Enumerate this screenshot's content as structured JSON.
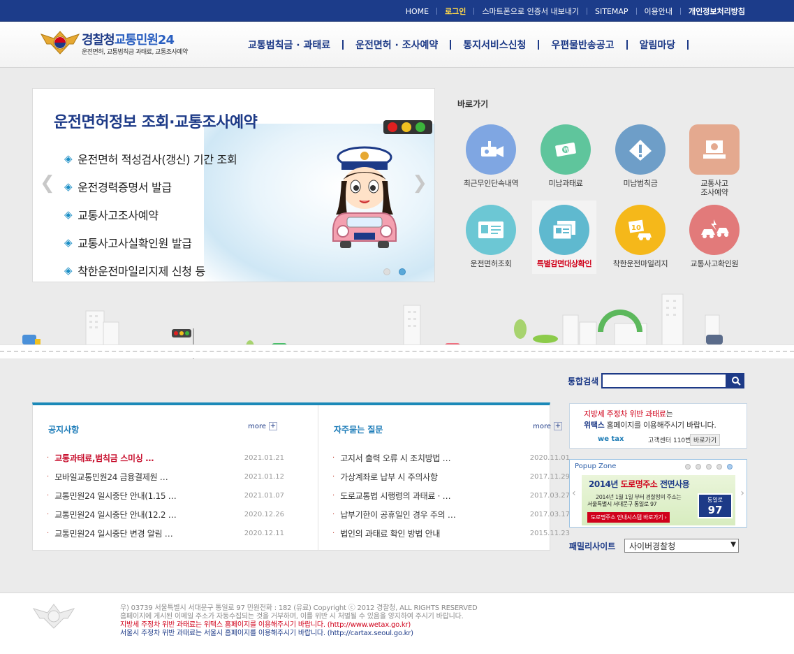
{
  "topbar": {
    "home": "HOME",
    "login": "로그인",
    "smartphone": "스마트폰으로 인증서 내보내기",
    "sitemap": "SITEMAP",
    "guide": "이용안내",
    "privacy": "개인정보처리방침"
  },
  "logo": {
    "main_a": "경찰청",
    "main_b": "교통민원24",
    "sub": "운전면허, 교통범칙금 과태료, 교통조사예약"
  },
  "gnb": [
    "교통범칙금 · 과태료",
    "운전면허 · 조사예약",
    "통지서비스신청",
    "우편물반송공고",
    "알림마당"
  ],
  "slider": {
    "title": "운전면허정보 조회·교통조사예약",
    "items": [
      "운전면허 적성검사(갱신) 기간 조회",
      "운전경력증명서 발급",
      "교통사고조사예약",
      "교통사고사실확인원 발급",
      "착한운전마일리지제 신청 등"
    ],
    "active_dot": 2
  },
  "quick": {
    "title": "바로가기",
    "items": [
      {
        "label": "최근무인단속내역",
        "icon": "camera-icon",
        "color": "#7fa6e2"
      },
      {
        "label": "미납과태료",
        "icon": "money-icon",
        "color": "#5fc59c"
      },
      {
        "label": "미납범칙금",
        "icon": "warning-icon",
        "color": "#6e9ec8"
      },
      {
        "label": "교통사고\n조사예약",
        "icon": "computer-icon",
        "color": "#e4a98f"
      },
      {
        "label": "운전면허조회",
        "icon": "license-icon",
        "color": "#6cc7d4"
      },
      {
        "label": "특별감면대상확인",
        "icon": "documents-icon",
        "color": "#5fb9cf"
      },
      {
        "label": "착한운전마일리지",
        "icon": "mileage-icon",
        "color": "#f5b81a"
      },
      {
        "label": "교통사고확인원",
        "icon": "accident-icon",
        "color": "#e27a7a"
      }
    ]
  },
  "search": {
    "label": "통합검색",
    "placeholder": ""
  },
  "notice": {
    "title": "공지사항",
    "more": "more",
    "items": [
      {
        "text": "교통과태료,범칙금 스미싱 …",
        "date": "2021.01.21"
      },
      {
        "text": "모바일교통민원24 금융결제원 …",
        "date": "2021.01.12"
      },
      {
        "text": "교통민원24 일시중단 안내(1.15 …",
        "date": "2021.01.07"
      },
      {
        "text": "교통민원24 일시중단 안내(12.2 …",
        "date": "2020.12.26"
      },
      {
        "text": "교통민원24 일시중단 변경 알림 …",
        "date": "2020.12.11"
      }
    ]
  },
  "faq": {
    "title": "자주묻는 질문",
    "more": "more",
    "items": [
      {
        "text": "고지서 출력 오류 시 조치방법 …",
        "date": "2020.11.01"
      },
      {
        "text": "가상계좌로 납부 시 주의사항",
        "date": "2017.11.29"
      },
      {
        "text": "도로교통법 시행령의 과태료 · …",
        "date": "2017.03.27"
      },
      {
        "text": "납부기한이 공휴일인 경우 주의 …",
        "date": "2017.03.17"
      },
      {
        "text": "법인의 과태료 확인 방법 안내",
        "date": "2015.11.23"
      }
    ]
  },
  "banner": {
    "line1_red": "지방세 주정차 위반 과태료",
    "line1_rest": "는",
    "line2_bold": "위택스",
    "line2_rest": " 홈페이지를 이용해주시기 바랍니다.",
    "brand": "we tax",
    "center": "고객센터 110번",
    "button": "바로가기"
  },
  "popup": {
    "zone": "Popup Zone",
    "head_a": "2014년 ",
    "head_b": "도로명주소",
    "head_c": " 전면사용",
    "sub1": "2014년 1월 1일 부터 경찰청의 주소는",
    "sub2": "서울특별시 서대문구 통일로 97",
    "btn": "도로명주소 안내시스템 바로가기 ›",
    "sign_top": "통일로",
    "sign_num": "97"
  },
  "family": {
    "label": "패밀리사이트",
    "selected": "사이버경찰청"
  },
  "footer": {
    "addr": "우) 03739 서울특별시 서대문구 통일로 97  민원전화 : 182 (유료)       Copyright ⓒ 2012 경찰청, ALL RIGHTS RESERVED",
    "email": "홈페이지에 게시된 이메일 주소가 자동수집되는 것을 거부하며, 이를 위반 시 처벌될 수 있음을 양지하여 주시기 바랍니다.",
    "wetax": "지방세 주정차 위반 과태료는 위택스 홈페이지를 이용해주시기 바랍니다. (http://www.wetax.go.kr)",
    "seoul": "서울시 주정차 위반 과태료는 서울시 홈페이지를 이용해주시기 바랍니다. (http://cartax.seoul.go.kr)"
  }
}
